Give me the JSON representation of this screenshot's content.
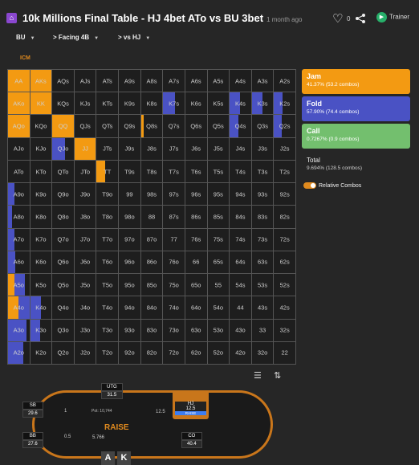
{
  "header": {
    "logo_icon": "bank-icon",
    "title": "10k Millions Final Table - HJ 4bet ATo vs BU 3bet",
    "time": "1 month ago",
    "likes": "0",
    "trainer": "Trainer"
  },
  "breadcrumbs": {
    "position": "BU",
    "facing": "Facing 4B",
    "vs": "vs HJ"
  },
  "icm": "ICM",
  "colors": {
    "jam": "#f39a12",
    "fold": "#4a52c4",
    "call": "#73bf6e",
    "raise_accent": "#e08a1e"
  },
  "matrix": {
    "rows": [
      [
        "AA",
        "AKs",
        "AQs",
        "AJs",
        "ATs",
        "A9s",
        "A8s",
        "A7s",
        "A6s",
        "A5s",
        "A4s",
        "A3s",
        "A2s"
      ],
      [
        "AKo",
        "KK",
        "KQs",
        "KJs",
        "KTs",
        "K9s",
        "K8s",
        "K7s",
        "K6s",
        "K5s",
        "K4s",
        "K3s",
        "K2s"
      ],
      [
        "AQo",
        "KQo",
        "QQ",
        "QJs",
        "QTs",
        "Q9s",
        "Q8s",
        "Q7s",
        "Q6s",
        "Q5s",
        "Q4s",
        "Q3s",
        "Q2s"
      ],
      [
        "AJo",
        "KJo",
        "QJo",
        "JJ",
        "JTs",
        "J9s",
        "J8s",
        "J7s",
        "J6s",
        "J5s",
        "J4s",
        "J3s",
        "J2s"
      ],
      [
        "ATo",
        "KTo",
        "QTo",
        "JTo",
        "TT",
        "T9s",
        "T8s",
        "T7s",
        "T6s",
        "T5s",
        "T4s",
        "T3s",
        "T2s"
      ],
      [
        "A9o",
        "K9o",
        "Q9o",
        "J9o",
        "T9o",
        "99",
        "98s",
        "97s",
        "96s",
        "95s",
        "94s",
        "93s",
        "92s"
      ],
      [
        "A8o",
        "K8o",
        "Q8o",
        "J8o",
        "T8o",
        "98o",
        "88",
        "87s",
        "86s",
        "85s",
        "84s",
        "83s",
        "82s"
      ],
      [
        "A7o",
        "K7o",
        "Q7o",
        "J7o",
        "T7o",
        "97o",
        "87o",
        "77",
        "76s",
        "75s",
        "74s",
        "73s",
        "72s"
      ],
      [
        "A6o",
        "K6o",
        "Q6o",
        "J6o",
        "T6o",
        "96o",
        "86o",
        "76o",
        "66",
        "65s",
        "64s",
        "63s",
        "62s"
      ],
      [
        "A5o",
        "K5o",
        "Q5o",
        "J5o",
        "T5o",
        "95o",
        "85o",
        "75o",
        "65o",
        "55",
        "54s",
        "53s",
        "52s"
      ],
      [
        "A4o",
        "K4o",
        "Q4o",
        "J4o",
        "T4o",
        "94o",
        "84o",
        "74o",
        "64o",
        "54o",
        "44",
        "43s",
        "42s"
      ],
      [
        "A3o",
        "K3o",
        "Q3o",
        "J3o",
        "T3o",
        "93o",
        "83o",
        "73o",
        "63o",
        "53o",
        "43o",
        "33",
        "32s"
      ],
      [
        "A2o",
        "K2o",
        "Q2o",
        "J2o",
        "T2o",
        "92o",
        "82o",
        "72o",
        "62o",
        "52o",
        "42o",
        "32o",
        "22"
      ]
    ],
    "strategy": {
      "AA": {
        "jam": 1
      },
      "AKs": {
        "jam": 1
      },
      "AKo": {
        "jam": 1
      },
      "KK": {
        "jam": 1
      },
      "QQ": {
        "jam": 1
      },
      "JJ": {
        "jam": 1
      },
      "TT": {
        "jam": 0.4
      },
      "AQo": {
        "jam": 1
      },
      "KQo": {
        "fold": 0
      },
      "K7s": {
        "fold": 0.55
      },
      "K4s": {
        "fold": 0.5
      },
      "K3s": {
        "fold": 0.5
      },
      "K2s": {
        "fold": 0.4
      },
      "Q8s": {
        "jam": 0.12
      },
      "Q4s": {
        "fold": 0.4
      },
      "Q2s": {
        "fold": 0.35
      },
      "QJo": {
        "fold": 0.6
      },
      "A9o": {
        "fold": 0.3
      },
      "A8o": {
        "fold": 0.2
      },
      "A7o": {
        "fold": 0.3
      },
      "A6o": {
        "fold": 0.35
      },
      "A5o": {
        "jam": 0.3,
        "fold": 0.5
      },
      "A4o": {
        "jam": 0.5,
        "fold": 0.5
      },
      "K4o": {
        "fold": 0.5
      },
      "A3o": {
        "fold": 0.85
      },
      "K3o": {
        "fold": 0.45
      },
      "A2o": {
        "fold": 0.7
      }
    }
  },
  "legend": {
    "jam_title": "Jam",
    "jam_sub": "41.37% (53.2 combos)",
    "fold_title": "Fold",
    "fold_sub": "57.90% (74.4 combos)",
    "call_title": "Call",
    "call_sub": "0.7267% (0.9 combos)",
    "total_title": "Total",
    "total_sub": "9.694% (128.5 combos)",
    "toggle": "Relative Combos"
  },
  "table": {
    "brand": "RAISE",
    "pot": "Pot: 10,744",
    "seats": [
      {
        "pos": "UTG",
        "stack": "31.5"
      },
      {
        "pos": "SB",
        "stack": "29.6"
      },
      {
        "pos": "BB",
        "stack": "27.6"
      },
      {
        "pos": "HJ",
        "stack": "12.5"
      },
      {
        "pos": "CO",
        "stack": "40.4"
      }
    ],
    "hj_action": "RAISE",
    "cards": [
      "A",
      "K"
    ],
    "chip_left": "1",
    "chip_mid": "0.5",
    "chip_right": "12.5",
    "blind": "5.766"
  }
}
